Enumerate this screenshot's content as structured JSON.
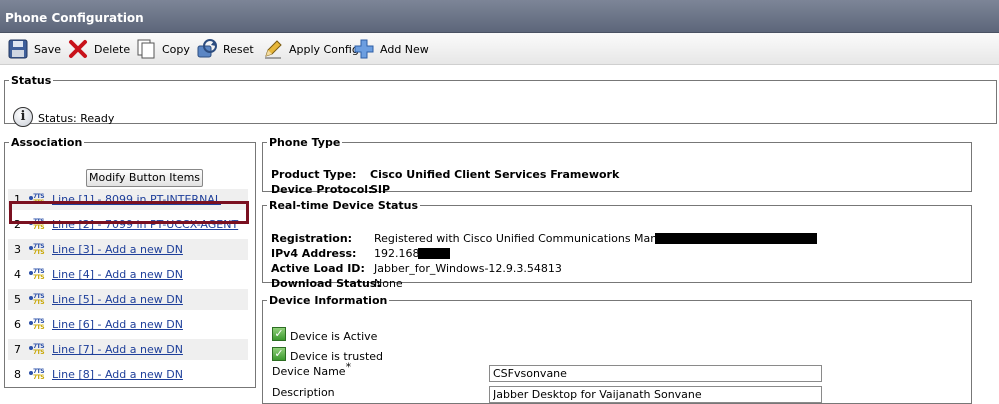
{
  "window": {
    "title": "Phone Configuration"
  },
  "toolbar": {
    "save": "Save",
    "delete": "Delete",
    "copy": "Copy",
    "reset": "Reset",
    "apply_config": "Apply Config",
    "add_new": "Add New"
  },
  "status": {
    "legend": "Status",
    "text": "Status: Ready",
    "icon": "info-icon"
  },
  "association": {
    "legend": "Association",
    "modify_button": "Modify Button Items",
    "lines": [
      {
        "num": "1",
        "label": "Line [1] - 8099 in PT-INTERNAL"
      },
      {
        "num": "2",
        "label": "Line [2] - 7099 in PT-UCCX-AGENT",
        "selected": true
      },
      {
        "num": "3",
        "label": "Line [3] - Add a new DN"
      },
      {
        "num": "4",
        "label": "Line [4] - Add a new DN"
      },
      {
        "num": "5",
        "label": "Line [5] - Add a new DN"
      },
      {
        "num": "6",
        "label": "Line [6] - Add a new DN"
      },
      {
        "num": "7",
        "label": "Line [7] - Add a new DN"
      },
      {
        "num": "8",
        "label": "Line [8] - Add a new DN"
      }
    ],
    "line_icon_top": "7TS",
    "line_icon_bottom": "7TS"
  },
  "phone_type": {
    "legend": "Phone Type",
    "product_type_label": "Product Type:",
    "product_type_value": "Cisco Unified Client Services Framework",
    "device_protocol_label": "Device Protocol:",
    "device_protocol_value": "SIP"
  },
  "realtime": {
    "legend": "Real-time Device Status",
    "registration_label": "Registration:",
    "registration_value": "Registered with Cisco Unified Communications Manager",
    "ipv4_label": "IPv4 Address:",
    "ipv4_value": "192.168.",
    "active_load_label": "Active Load ID:",
    "active_load_value": "Jabber_for_Windows-12.9.3.54813",
    "download_label": "Download Status:",
    "download_value": "None"
  },
  "device_info": {
    "legend": "Device Information",
    "is_active": "Device is Active",
    "is_trusted": "Device is trusted",
    "device_name_label": "Device Name",
    "device_name_required": "*",
    "device_name_value": "CSFvsonvane",
    "description_label": "Description",
    "description_value": "Jabber Desktop for Vaijanath Sonvane"
  },
  "colors": {
    "titlebar": "#6b7386",
    "link": "#1e3f9a",
    "selected_outline": "#7a1020"
  }
}
